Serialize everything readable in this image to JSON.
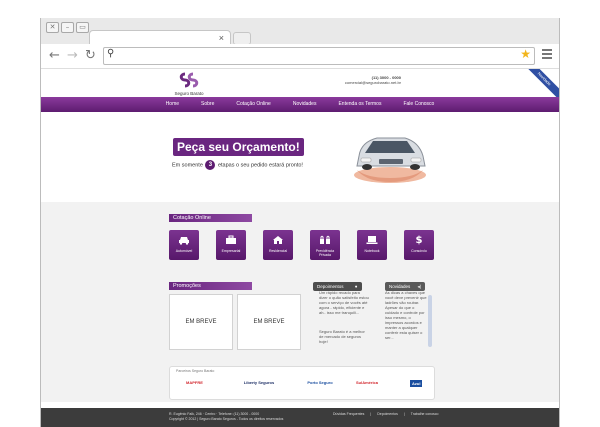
{
  "browser": {
    "window_buttons": [
      "✕",
      "–",
      "▭"
    ],
    "tab_close": "×",
    "address_value": "",
    "nav": {
      "back": "←",
      "forward": "→",
      "reload": "↻"
    }
  },
  "site": {
    "logo_text": "Seguro Barato",
    "contact_phone": "(11) 3000 - 0000",
    "contact_email": "comercial@segurobarato.net.br",
    "ribbon": "Novidade",
    "nav_items": [
      "Home",
      "Sobre",
      "Cotação Online",
      "Novidades",
      "Entenda os Termos",
      "Fale Conosco"
    ],
    "hero": {
      "title": "Peça seu Orçamento!",
      "sub_before": "Em somente",
      "sub_num": "3",
      "sub_after": "etapas o seu pedido estará pronto!"
    },
    "cotacao": {
      "title": "Cotação Online",
      "items": [
        {
          "label": "Automóvel",
          "icon": "car-icon",
          "glyph": "🚗"
        },
        {
          "label": "Empresarial",
          "icon": "briefcase-icon",
          "glyph": "▣"
        },
        {
          "label": "Residencial",
          "icon": "house-icon",
          "glyph": "⌂"
        },
        {
          "label": "Previdência Privada",
          "icon": "lock-icon",
          "glyph": "⊞"
        },
        {
          "label": "Notebook",
          "icon": "laptop-icon",
          "glyph": "▭"
        },
        {
          "label": "Consórcio",
          "icon": "dollar-icon",
          "glyph": "$"
        }
      ]
    },
    "promocoes": {
      "title": "Promoções",
      "boxes": [
        "EM BREVE",
        "EM BREVE"
      ]
    },
    "depoimentos": {
      "title": "Depoimentos",
      "text1": "Um rápido recado para dizer o quão satisfeito estou com o serviço de vocês até agora - rápido, eficiente e ah.. isso me tranquili...",
      "text2": "Seguro Barato é a melhor de mercado de seguros hoje!"
    },
    "novidades": {
      "title": "Novidades",
      "text": "As dicas a chaves que você deve prevenir que ladrões vão roubar. Apesar do que o cuidado e controle por isso mesmo, o impressos acordos e manter a qualquer conferir esta quiser o ser..."
    },
    "partners": {
      "title": "Parceiros Seguro Barato",
      "logos": [
        {
          "name": "MAPFRE",
          "color": "#d2262d"
        },
        {
          "name": "Liberty Seguros",
          "color": "#1d2f66"
        },
        {
          "name": "Porto Seguro",
          "color": "#1b4fa0"
        },
        {
          "name": "SulAmérica",
          "color": "#d2262d"
        },
        {
          "name": "Azul",
          "color": "#1b4fa0"
        }
      ]
    },
    "footer": {
      "left_line1": "R. Eugênio Falk, 246 · Centro · Telefone: (11) 3000 - 0000",
      "left_line2": "Copyright © 2012 | Seguro Barato Seguros - Todos os direitos reservados",
      "links": [
        "Dúvidas Frequentes",
        "Depoimentos",
        "Trabalhe conosco"
      ]
    }
  },
  "colors": {
    "brand_purple": "#6a2680",
    "nav_purple": "#5d1c70",
    "footer": "#3c3c3c"
  }
}
